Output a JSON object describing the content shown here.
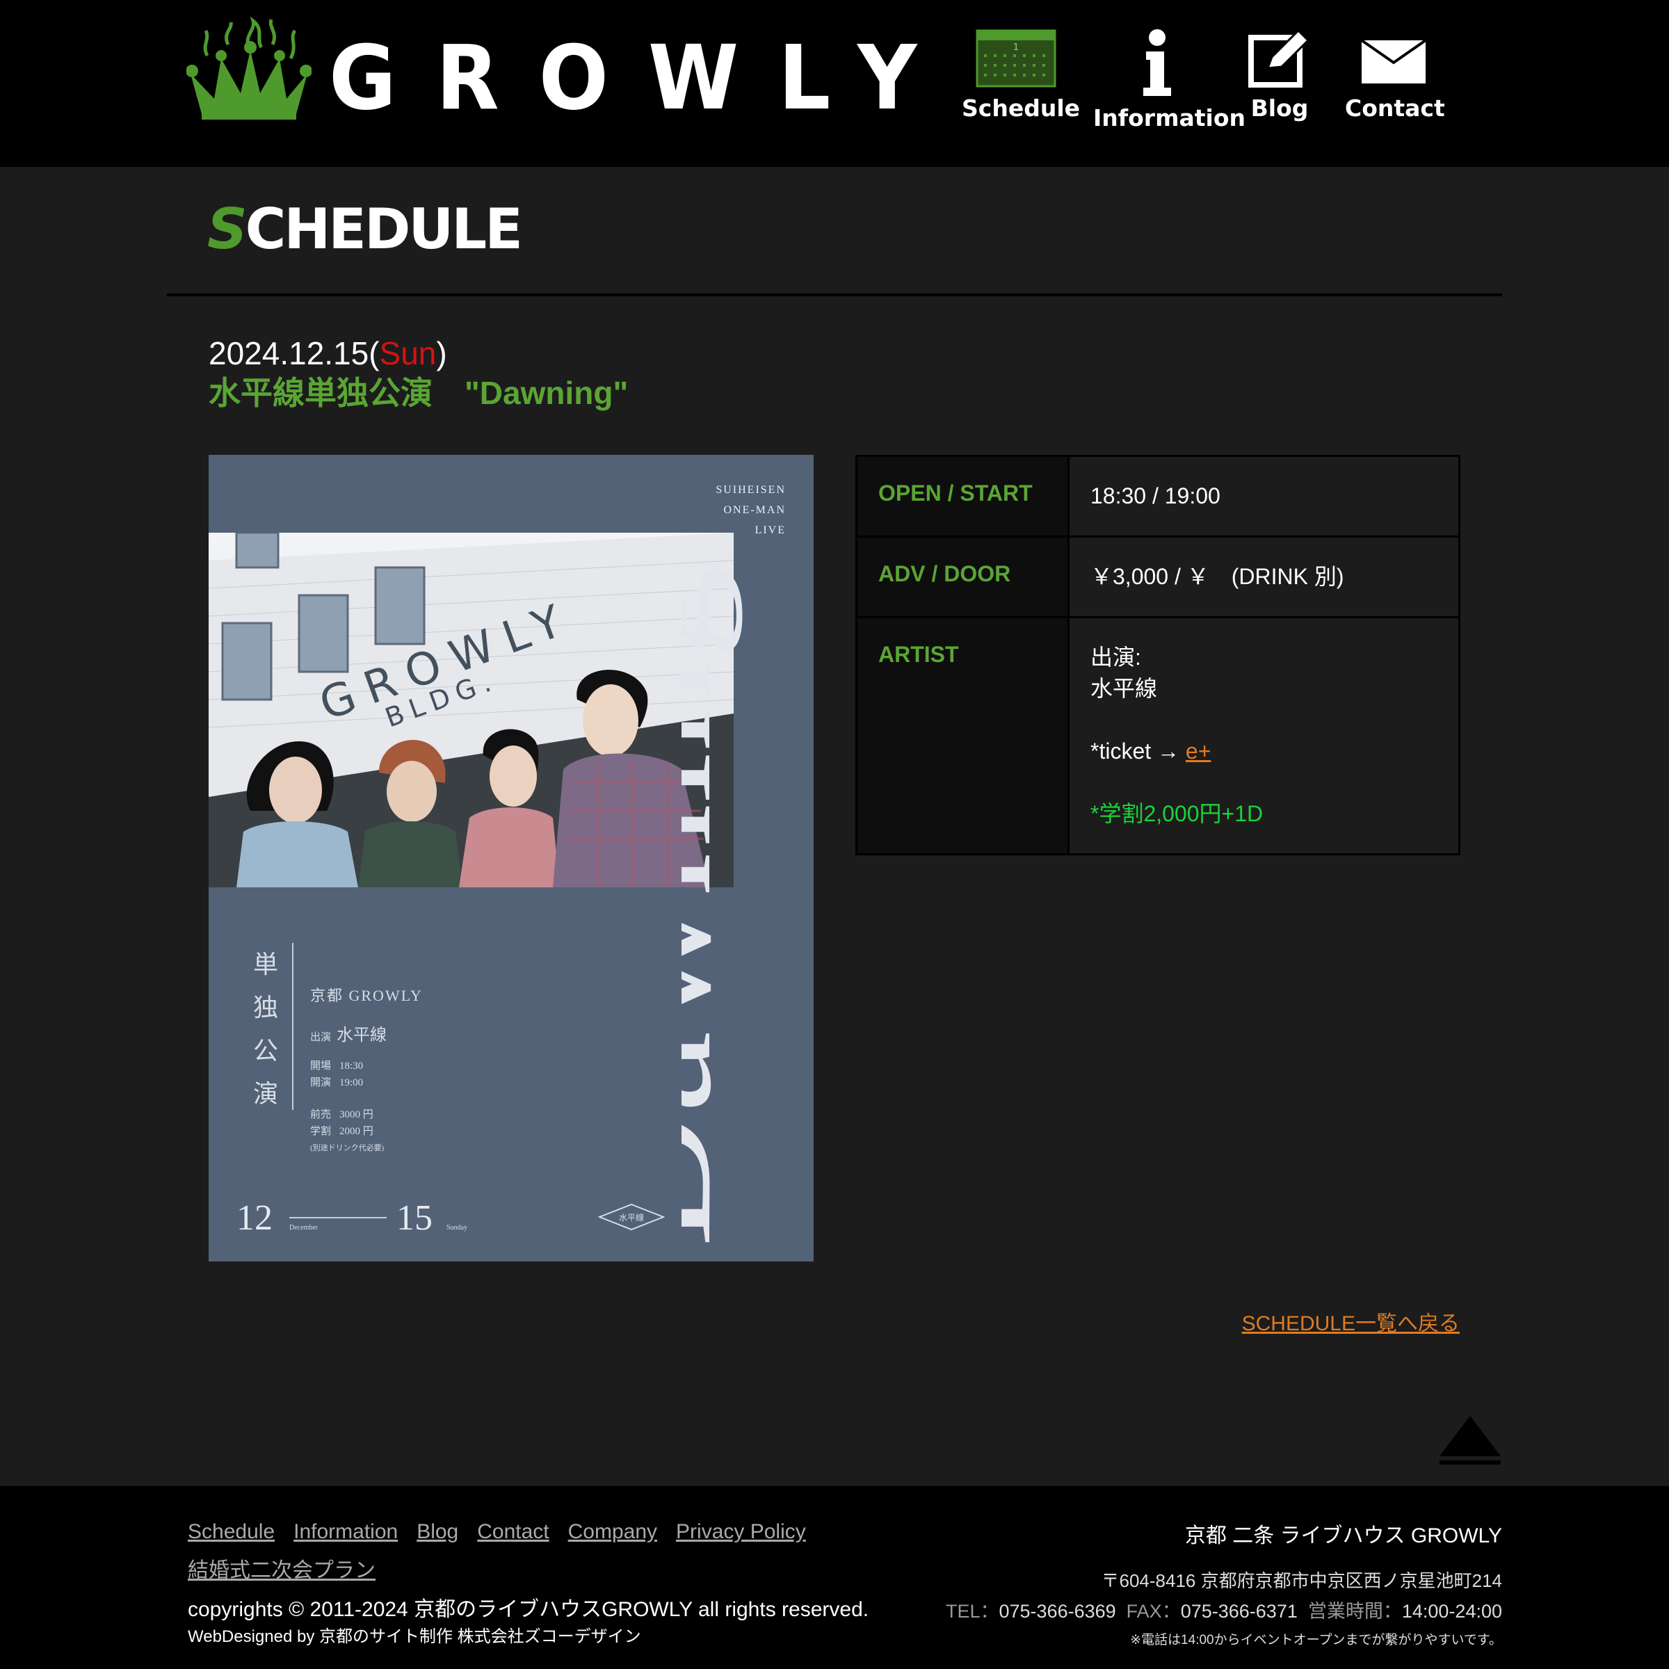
{
  "header": {
    "brand": "GROWLY",
    "nav": [
      {
        "label": "Schedule",
        "icon": "calendar-icon"
      },
      {
        "label": "Information",
        "icon": "info-icon"
      },
      {
        "label": "Blog",
        "icon": "pencil-icon"
      },
      {
        "label": "Contact",
        "icon": "envelope-icon"
      }
    ]
  },
  "section_title": {
    "first": "S",
    "rest": "CHEDULE"
  },
  "event": {
    "date": "2024.12.15(",
    "dow": "Sun",
    "date_close": ")",
    "title": "水平線単独公演　\"Dawning\""
  },
  "flyer": {
    "top_lines": [
      "SUIHEISEN",
      "ONE-MAN",
      "LIVE"
    ],
    "building_text": "GROWLY",
    "building_sub": "BLDG.",
    "big_title": "Dawning",
    "vertical": [
      "単",
      "独",
      "公",
      "演"
    ],
    "venue": "京都 GROWLY",
    "performer_label": "出演",
    "performer": "水平線",
    "open_label": "開場",
    "open_time": "18:30",
    "start_label": "開演",
    "start_time": "19:00",
    "adv_label": "前売",
    "adv_price": "3000 円",
    "student_label": "学割",
    "student_price": "2000 円",
    "drink_note": "(別途ドリンク代必要)",
    "month": "12",
    "month_name": "December",
    "day": "15",
    "day_name": "Sunday",
    "stamp": "水平線"
  },
  "table": {
    "rows": [
      {
        "key": "OPEN / START",
        "value": "18:30 / 19:00"
      },
      {
        "key": "ADV / DOOR",
        "value": "￥3,000 / ￥　(DRINK 別)"
      },
      {
        "key": "ARTIST"
      }
    ],
    "artist_label": "出演:",
    "artist_name": "水平線",
    "ticket_prefix": "*ticket → ",
    "ticket_link": "e+",
    "student_note": "*学割2,000円+1D"
  },
  "back_link": "SCHEDULE一覧へ戻る",
  "footer": {
    "links": [
      "Schedule",
      "Information",
      "Blog",
      "Contact",
      "Company",
      "Privacy Policy",
      "結婚式二次会プラン"
    ],
    "copyright": "copyrights © 2011-2024 京都のライブハウスGROWLY all rights reserved.",
    "designed": "WebDesigned by 京都のサイト制作 株式会社ズコーデザイン",
    "venue_name": "京都 二条 ライブハウス GROWLY",
    "address": "〒604-8416 京都府京都市中京区西ノ京星池町214",
    "tel_label": "TEL：",
    "tel": "075-366-6369",
    "fax_label": "FAX：",
    "fax": "075-366-6371",
    "hours_label": "営業時間：",
    "hours": "14:00-24:00",
    "note": "※電話は14:00からイベントオープンまでが繋がりやすいです。"
  },
  "colors": {
    "accent_green": "#5aa534",
    "link_orange": "#e07b22",
    "sunday_red": "#d01414",
    "note_green": "#19d43a"
  }
}
